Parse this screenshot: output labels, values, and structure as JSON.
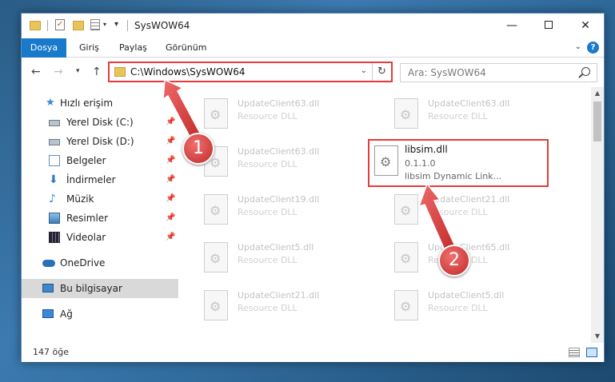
{
  "window": {
    "title": "SysWOW64"
  },
  "ribbon": {
    "tabs": [
      "Dosya",
      "Giriş",
      "Paylaş",
      "Görünüm"
    ],
    "active_tab": "Dosya"
  },
  "address_bar": {
    "path": "C:\\Windows\\SysWOW64"
  },
  "search": {
    "placeholder": "Ara: SysWOW64"
  },
  "sidebar": {
    "items": [
      {
        "label": "Hızlı erişim",
        "icon": "star-icon",
        "pinned": false
      },
      {
        "label": "Yerel Disk (C:)",
        "icon": "disk-icon",
        "pinned": true
      },
      {
        "label": "Yerel Disk (D:)",
        "icon": "disk-icon",
        "pinned": true
      },
      {
        "label": "Belgeler",
        "icon": "documents-icon",
        "pinned": true
      },
      {
        "label": "İndirmeler",
        "icon": "download-icon",
        "pinned": true
      },
      {
        "label": "Müzik",
        "icon": "music-icon",
        "pinned": true
      },
      {
        "label": "Resimler",
        "icon": "pictures-icon",
        "pinned": true
      },
      {
        "label": "Videolar",
        "icon": "video-icon",
        "pinned": true
      },
      {
        "label": "OneDrive",
        "icon": "cloud-icon",
        "pinned": false
      },
      {
        "label": "Bu bilgisayar",
        "icon": "computer-icon",
        "pinned": false,
        "selected": true
      },
      {
        "label": "Ağ",
        "icon": "network-icon",
        "pinned": false
      }
    ]
  },
  "files": [
    {
      "name": "UpdateClient63.dll",
      "desc": "Resource DLL"
    },
    {
      "name": "UpdateClient63.dll",
      "desc": "Resource DLL"
    },
    {
      "name": "UpdateClient63.dll",
      "desc": "Resource DLL"
    },
    {
      "name": "UpdateClient19.dll",
      "desc": "Resource DLL"
    },
    {
      "name": "UpdateClient21.dll",
      "desc": "Resource DLL"
    },
    {
      "name": "UpdateClient5.dll",
      "desc": "Resource DLL"
    },
    {
      "name": "UpdateClient65.dll",
      "desc": "Resource DLL"
    },
    {
      "name": "UpdateClient21.dll",
      "desc": "Resource DLL"
    },
    {
      "name": "UpdateClient5.dll",
      "desc": "Resource DLL"
    }
  ],
  "highlighted_file": {
    "name": "libsim.dll",
    "version": "0.1.1.0",
    "desc": "libsim Dynamic Link..."
  },
  "status": {
    "count": "147 öğe"
  },
  "annotations": {
    "step1": "1",
    "step2": "2"
  },
  "colors": {
    "accent": "#1979ca",
    "highlight": "#e43c3c"
  }
}
